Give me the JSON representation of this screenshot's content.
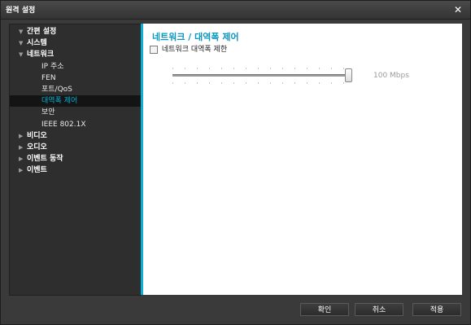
{
  "window": {
    "title": "원격 설정",
    "close_icon": "✕"
  },
  "sidebar": {
    "items": [
      {
        "label": "간편 설정",
        "arrow": "▼",
        "level": 0,
        "selected": false
      },
      {
        "label": "시스템",
        "arrow": "▼",
        "level": 0,
        "selected": false
      },
      {
        "label": "네트워크",
        "arrow": "▼",
        "level": 0,
        "selected": false
      },
      {
        "label": "IP 주소",
        "arrow": "",
        "level": 1,
        "selected": false
      },
      {
        "label": "FEN",
        "arrow": "",
        "level": 1,
        "selected": false
      },
      {
        "label": "포트/QoS",
        "arrow": "",
        "level": 1,
        "selected": false
      },
      {
        "label": "대역폭 제어",
        "arrow": "",
        "level": 1,
        "selected": true
      },
      {
        "label": "보안",
        "arrow": "",
        "level": 1,
        "selected": false
      },
      {
        "label": "IEEE 802.1X",
        "arrow": "",
        "level": 1,
        "selected": false
      },
      {
        "label": "비디오",
        "arrow": "▶",
        "level": 0,
        "selected": false
      },
      {
        "label": "오디오",
        "arrow": "▶",
        "level": 0,
        "selected": false
      },
      {
        "label": "이벤트 동작",
        "arrow": "▶",
        "level": 0,
        "selected": false
      },
      {
        "label": "이벤트",
        "arrow": "▶",
        "level": 0,
        "selected": false
      }
    ]
  },
  "content": {
    "title": "네트워크 / 대역폭 제어",
    "limit_checkbox_label": "네트워크 대역폭 제한",
    "limit_checked": false,
    "slider": {
      "value_label": "100 Mbps",
      "fraction": 1.0
    }
  },
  "footer": {
    "ok_label": "확인",
    "cancel_label": "취소",
    "apply_label": "적용"
  },
  "colors": {
    "accent": "#0bb0d6",
    "title_text": "#0a97c0",
    "selected_text": "#00b4d8"
  }
}
